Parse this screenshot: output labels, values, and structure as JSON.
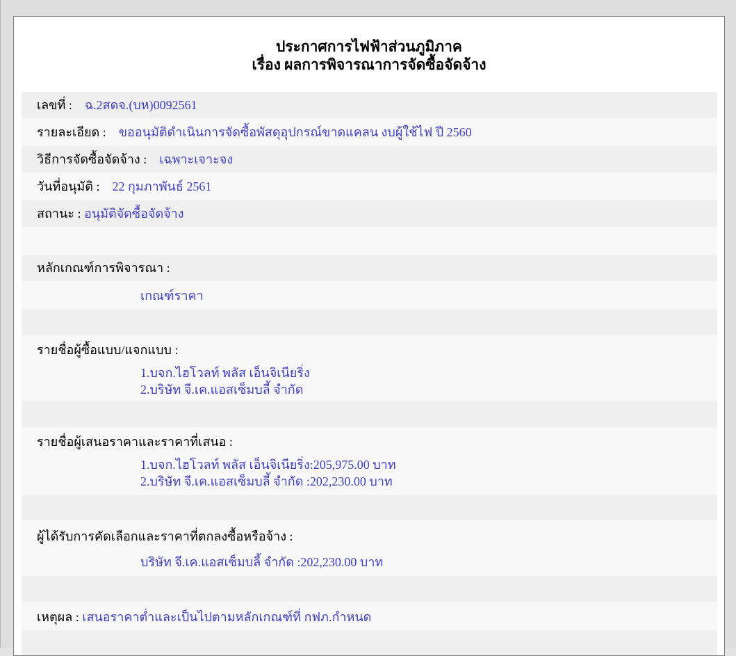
{
  "header": {
    "title_line1": "ประกาศการไฟฟ้าส่วนภูมิภาค",
    "title_line2": "เรื่อง ผลการพิจารณาการจัดซื้อจัดจ้าง"
  },
  "details": {
    "number_label": "เลขที่ :",
    "number_value": "ฉ.2สดจ.(บห)0092561",
    "description_label": "รายละเอียด :",
    "description_value": "ขออนุมัติดำเนินการจัดซื้อพัสดุอุปกรณ์ขาดแคลน งบผู้ใช้ไฟ ปี 2560",
    "method_label": "วิธีการจัดซื้อจัดจ้าง :",
    "method_value": "เฉพาะเจาะจง",
    "approval_date_label": "วันที่อนุมัติ :",
    "approval_date_value": "22 กุมภาพันธ์ 2561",
    "status_label": "สถานะ :",
    "status_value": "อนุมัติจัดซื้อจัดจ้าง"
  },
  "criteria": {
    "label": "หลักเกณฑ์การพิจารณา :",
    "value": "เกณฑ์ราคา"
  },
  "buyers": {
    "label": "รายชื่อผู้ซื้อแบบ/แจกแบบ :",
    "items": [
      "1.บจก.ไฮโวลท์ พลัส เอ็นจิเนียริ่ง",
      "2.บริษัท จี.เค.แอสเซ็มบลี้ จำกัด"
    ]
  },
  "bidders": {
    "label": "รายชื่อผู้เสนอราคาและราคาที่เสนอ :",
    "items": [
      "1.บจก.ไฮโวลท์ พลัส เอ็นจิเนียริ่ง:205,975.00 บาท",
      "2.บริษัท จี.เค.แอสเซ็มบลี้ จำกัด :202,230.00 บาท"
    ]
  },
  "winner": {
    "label": "ผู้ได้รับการคัดเลือกและราคาที่ตกลงซื้อหรือจ้าง :",
    "value": "บริษัท จี.เค.แอสเซ็มบลี้ จำกัด :202,230.00 บาท"
  },
  "reason": {
    "label": "เหตุผล :",
    "value": "เสนอราคาต่ำและเป็นไปตามหลักเกณฑ์ที่ กฟภ.กำหนด"
  }
}
